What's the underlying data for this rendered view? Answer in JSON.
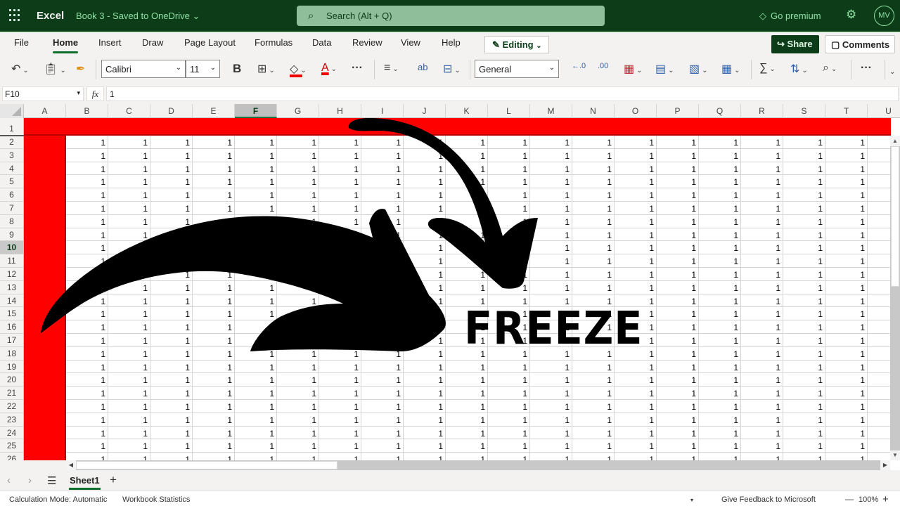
{
  "titlebar": {
    "app_name": "Excel",
    "doc_title": "Book 3  -  Saved to OneDrive ⌄",
    "search_placeholder": "Search (Alt + Q)",
    "premium_label": "Go premium",
    "avatar_initials": "MV",
    "icons": [
      "app-launcher-icon",
      "search-icon",
      "diamond-icon",
      "gear-icon"
    ]
  },
  "ribbon": {
    "tabs": [
      "File",
      "Home",
      "Insert",
      "Draw",
      "Page Layout",
      "Formulas",
      "Data",
      "Review",
      "View",
      "Help"
    ],
    "active_tab": "Home",
    "mode_label": "Editing",
    "share_label": "Share",
    "comments_label": "Comments",
    "font_name": "Calibri",
    "font_size": "11",
    "number_format": "General",
    "bold_label": "B",
    "more_label": "···",
    "accent_color": "#0c3d18",
    "fill_color": "#e00000",
    "font_color": "#e00000"
  },
  "formula_bar": {
    "name_box": "F10",
    "fx_label": "fx",
    "value": "1"
  },
  "grid": {
    "columns": [
      "A",
      "B",
      "C",
      "D",
      "E",
      "F",
      "G",
      "H",
      "I",
      "J",
      "K",
      "L",
      "M",
      "N",
      "O",
      "P",
      "Q",
      "R",
      "S",
      "T",
      "U"
    ],
    "rows": [
      "1",
      "2",
      "3",
      "4",
      "5",
      "6",
      "7",
      "8",
      "9",
      "10",
      "11",
      "12",
      "13",
      "14",
      "15",
      "16",
      "17",
      "18",
      "19",
      "20",
      "21",
      "22",
      "23",
      "24",
      "25",
      "26"
    ],
    "selected_column": "F",
    "selected_row": "10",
    "cell_value": "1",
    "filled_from_column": "B",
    "filled_to_column": "T",
    "filled_from_row": 2,
    "highlight_color": "#ff0000",
    "highlighted_row": "1",
    "highlighted_column": "A"
  },
  "overlay": {
    "text": "FREEZE",
    "arrows": [
      "large-curved-arrow",
      "small-curved-arrow"
    ]
  },
  "sheets": {
    "tabs": [
      "Sheet1"
    ],
    "active": "Sheet1",
    "add_label": "+"
  },
  "status": {
    "calc_mode": "Calculation Mode: Automatic",
    "workbook_stats": "Workbook Statistics",
    "feedback": "Give Feedback to Microsoft",
    "zoom": "100%",
    "zoom_out": "—",
    "zoom_in": "+"
  }
}
